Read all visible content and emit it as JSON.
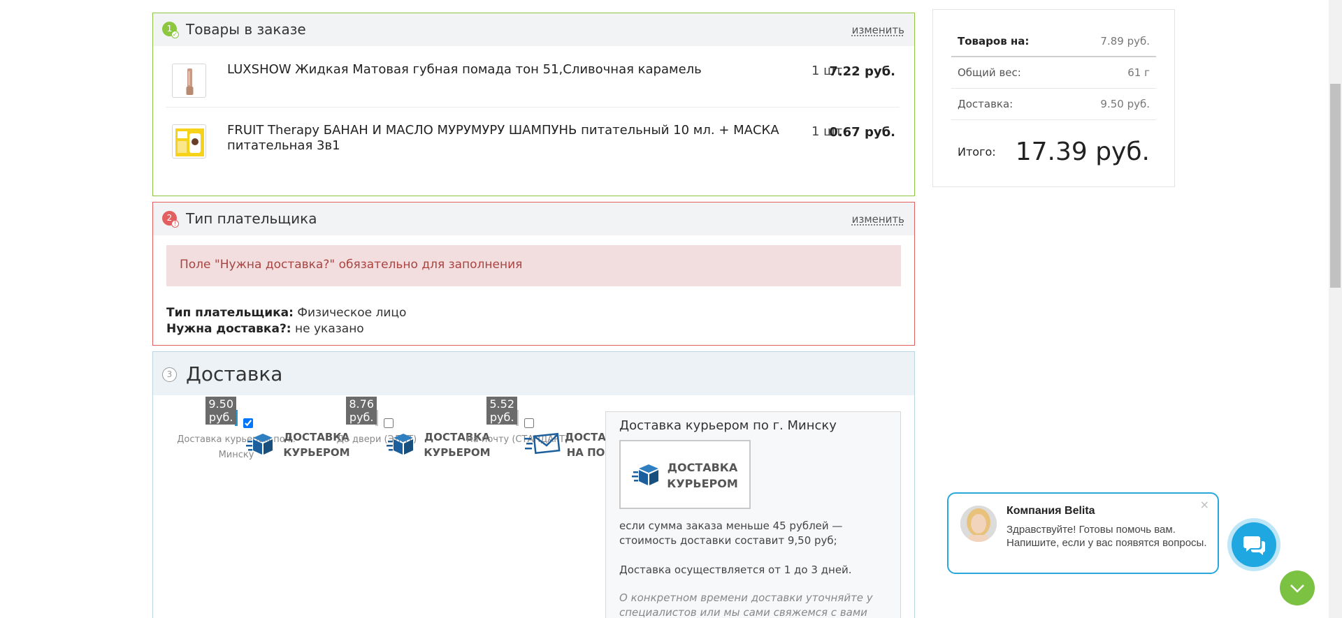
{
  "order_items": {
    "step": "1",
    "title": "Товары в заказе",
    "edit_label": "изменить",
    "products": [
      {
        "name": "LUXSHOW Жидкая Матовая губная помада тон 51,Сливочная карамель",
        "qty": "1 шт",
        "price": "7.22 руб."
      },
      {
        "name": "FRUIT Therapy БАНАН И МАСЛО МУРУМУРУ ШАМПУНЬ питательный 10 мл. + МАСКА питательная 3в1",
        "qty": "1 шт",
        "price": "0.67 руб."
      }
    ]
  },
  "payer": {
    "step": "2",
    "title": "Тип плательщика",
    "edit_label": "изменить",
    "error": "Поле \"Нужна доставка?\" обязательно для заполнения",
    "type_label": "Тип плательщика:",
    "type_value": "Физическое лицо",
    "delivery_label": "Нужна доставка?:",
    "delivery_value": "не указано"
  },
  "delivery": {
    "step": "3",
    "title": "Доставка",
    "options": [
      {
        "label_line1": "ДОСТАВКА",
        "label_line2": "КУРЬЕРОМ",
        "price": "9.50 руб.",
        "caption": "Доставка курьером по г. Минску",
        "checked": true
      },
      {
        "label_line1": "ДОСТАВКА",
        "label_line2": "КУРЬЕРОМ",
        "price": "8.76 руб.",
        "caption": "До двери (ЭЛИТ)",
        "checked": false
      },
      {
        "label_line1": "ДОСТАВКА",
        "label_line2": "НА ПОЧТУ",
        "price": "5.52 руб.",
        "caption": "На почту (СТАНДАРТ)",
        "checked": false
      }
    ],
    "detail": {
      "title": "Доставка курьером по г. Минску",
      "card_line1": "ДОСТАВКА",
      "card_line2": "КУРЬЕРОМ",
      "text1": "если сумма заказа меньше 45 рублей — стоимость доставки составит 9,50 руб;",
      "text2": "Доставка осуществляется от 1 до 3 дней.",
      "note": "О конкретном времени доставки уточняйте у специалистов или мы сами свяжемся с вами"
    }
  },
  "summary": {
    "goods_label": "Товаров на:",
    "goods_value": "7.89 руб.",
    "weight_label": "Общий вес:",
    "weight_value": "61 г",
    "delivery_label": "Доставка:",
    "delivery_value": "9.50 руб.",
    "total_label": "Итого:",
    "total_value": "17.39 руб."
  },
  "chat": {
    "company": "Компания Belita",
    "message": "Здравствуйте! Готовы помочь вам. Напишите, если у вас появятся вопросы.",
    "close": "×"
  },
  "colors": {
    "ok": "#8dc63f",
    "error": "#e35f5f",
    "accent": "#29a7dd",
    "icon_blue": "#1d5f9c"
  }
}
